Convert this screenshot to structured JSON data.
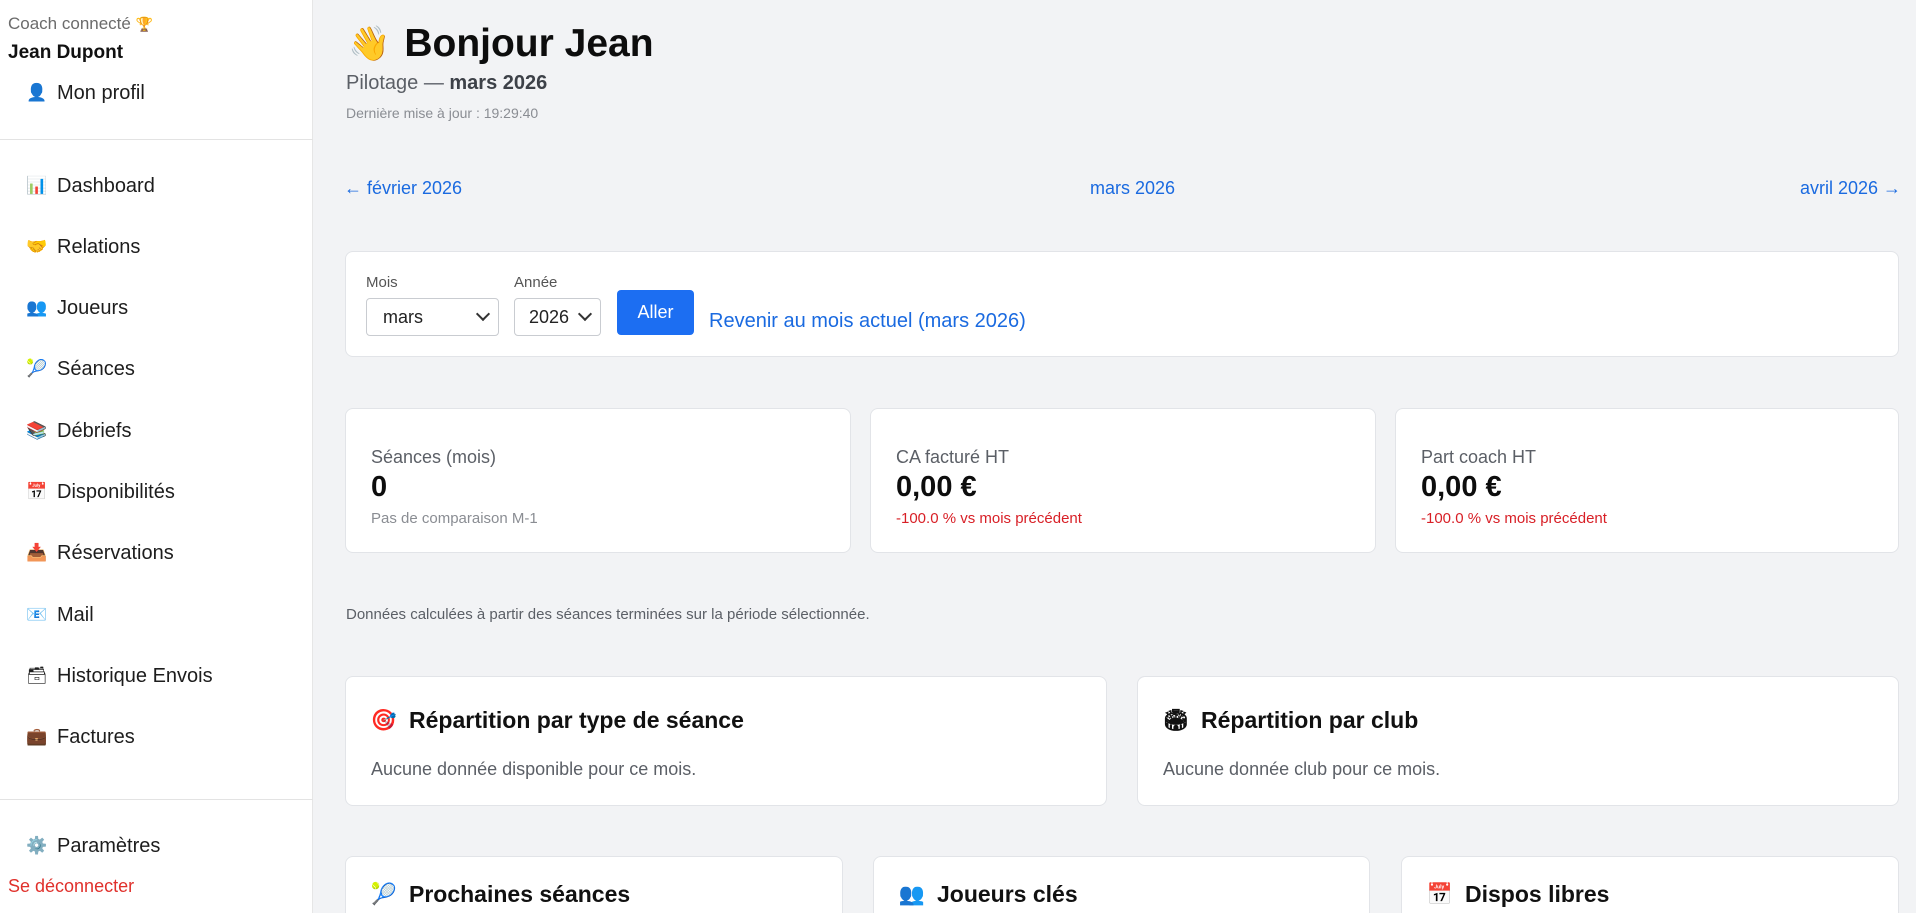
{
  "sidebar": {
    "coach_label": "Coach connecté",
    "coach_icon": "trophy-icon",
    "coach_name": "Jean Dupont",
    "profile": {
      "label": "Mon profil",
      "icon": "person-icon"
    },
    "items": [
      {
        "label": "Dashboard",
        "icon": "bar-chart-icon"
      },
      {
        "label": "Relations",
        "icon": "handshake-icon"
      },
      {
        "label": "Joueurs",
        "icon": "people-icon"
      },
      {
        "label": "Séances",
        "icon": "tennis-racket-icon"
      },
      {
        "label": "Débriefs",
        "icon": "books-icon"
      },
      {
        "label": "Disponibilités",
        "icon": "calendar-icon"
      },
      {
        "label": "Réservations",
        "icon": "inbox-icon"
      },
      {
        "label": "Mail",
        "icon": "mail-icon"
      },
      {
        "label": "Historique Envois",
        "icon": "archive-box-icon"
      },
      {
        "label": "Factures",
        "icon": "briefcase-icon"
      }
    ],
    "settings": {
      "label": "Paramètres",
      "icon": "gear-icon"
    },
    "logout": "Se déconnecter"
  },
  "header": {
    "greeting": "Bonjour Jean",
    "greeting_icon": "waving-hand-icon",
    "subtitle_prefix": "Pilotage — ",
    "subtitle_period": "mars 2026",
    "updated": "Dernière mise à jour : 19:29:40"
  },
  "month_nav": {
    "prev": "← février 2026",
    "current": "mars 2026",
    "next": "avril 2026 →"
  },
  "filters": {
    "month_label": "Mois",
    "month_value": "mars",
    "year_label": "Année",
    "year_value": "2026",
    "go_button": "Aller",
    "reset_link": "Revenir au mois actuel (mars 2026)"
  },
  "kpis": [
    {
      "label": "Séances (mois)",
      "value": "0",
      "sub": "Pas de comparaison M-1",
      "sub_status": "muted"
    },
    {
      "label": "CA facturé HT",
      "value": "0,00 €",
      "sub": "-100.0 % vs mois précédent",
      "sub_status": "negative"
    },
    {
      "label": "Part coach HT",
      "value": "0,00 €",
      "sub": "-100.0 % vs mois précédent",
      "sub_status": "negative"
    }
  ],
  "note": "Données calculées à partir des séances terminées sur la période sélectionnée.",
  "sections": {
    "by_type": {
      "title": "Répartition par type de séance",
      "icon": "target-icon",
      "empty": "Aucune donnée disponible pour ce mois."
    },
    "by_club": {
      "title": "Répartition par club",
      "icon": "stadium-icon",
      "empty": "Aucune donnée club pour ce mois."
    },
    "next_sessions": {
      "title": "Prochaines séances",
      "icon": "tennis-racket-icon"
    },
    "key_players": {
      "title": "Joueurs clés",
      "icon": "people-icon"
    },
    "free_slots": {
      "title": "Dispos libres",
      "icon": "calendar-icon"
    }
  },
  "colors": {
    "accent": "#1c6ef2",
    "link": "#1a6ae0",
    "negative": "#d81f26",
    "background": "#f2f3f5"
  }
}
